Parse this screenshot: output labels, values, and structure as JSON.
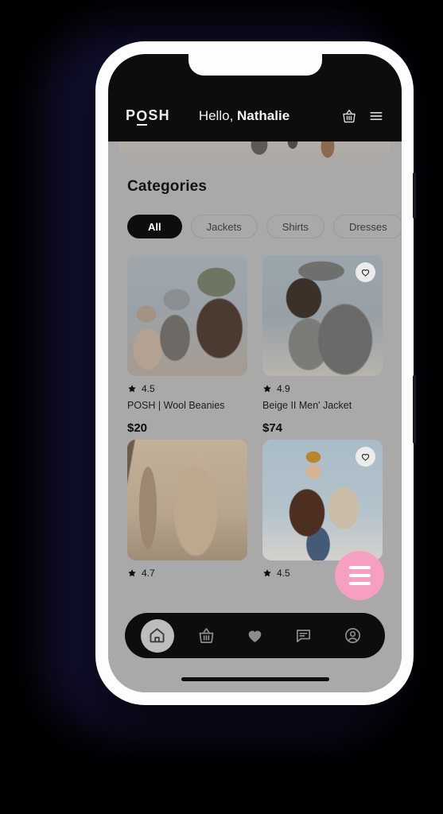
{
  "device": {
    "frame_color": "#fdfdfd",
    "backdrop_color": "#100f2c",
    "side_buttons": [
      "power-button",
      "volume-button"
    ]
  },
  "app": {
    "screen_background": "#a9a9a9",
    "accent_pink": "#f79fc0",
    "dark": "#0d0d0d"
  },
  "header": {
    "logo": {
      "before": "P",
      "o": "O",
      "after": "SH"
    },
    "greeting_prefix": "Hello, ",
    "greeting_name": "Nathalie",
    "cart_icon": "basket-icon",
    "menu_icon": "hamburger-menu-icon"
  },
  "section": {
    "title": "Categories"
  },
  "categories": [
    {
      "label": "All",
      "active": true
    },
    {
      "label": "Jackets",
      "active": false
    },
    {
      "label": "Shirts",
      "active": false
    },
    {
      "label": "Dresses",
      "active": false
    }
  ],
  "products": [
    {
      "name": "POSH | Wool Beanies",
      "rating": "4.5",
      "price": "$20",
      "favorited": false,
      "art": "art-beanies"
    },
    {
      "name": "Beige II Men' Jacket",
      "rating": "4.9",
      "price": "$74",
      "favorited": true,
      "art": "art-jacket-grey"
    },
    {
      "name": "",
      "rating": "4.7",
      "price": "",
      "favorited": false,
      "art": "art-puffer-beige"
    },
    {
      "name": "",
      "rating": "4.5",
      "price": "",
      "favorited": true,
      "art": "art-winter-pair"
    }
  ],
  "fab": {
    "icon": "hamburger-menu-icon",
    "color": "#f79fc0"
  },
  "bottom_nav": [
    {
      "icon": "home-icon",
      "active": true
    },
    {
      "icon": "basket-icon",
      "active": false
    },
    {
      "icon": "heart-icon",
      "active": false
    },
    {
      "icon": "chat-icon",
      "active": false
    },
    {
      "icon": "profile-icon",
      "active": false
    }
  ]
}
